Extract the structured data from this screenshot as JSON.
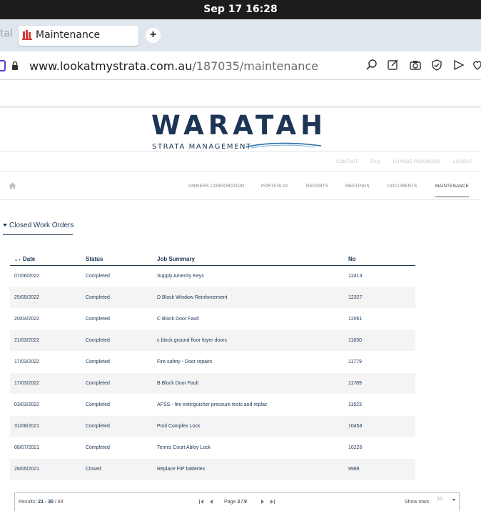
{
  "system": {
    "clock": "Sep 17  16:28"
  },
  "browser": {
    "prev_tab_fragment": "tal",
    "tab_title": "Maintenance",
    "new_tab_symbol": "+",
    "url_host": "www.lookatmystrata.com.au",
    "url_path": "/187035/maintenance"
  },
  "site": {
    "logo_word": "WARATAH",
    "logo_sub": "STRATA MANAGEMENT",
    "top_links": [
      "CONTACT",
      "FAQ",
      "CHANGE PASSWORD",
      "LOGOUT"
    ],
    "nav": [
      "OWNERS CORPORATION",
      "PORTFOLIO",
      "REPORTS",
      "MEETINGS",
      "DOCUMENTS",
      "MAINTENANCE"
    ],
    "active_nav": "MAINTENANCE"
  },
  "section": {
    "title": "Closed Work Orders"
  },
  "table": {
    "columns": [
      "Date",
      "Status",
      "Job Summary",
      "No"
    ],
    "rows": [
      {
        "date": "07/06/2022",
        "status": "Completed",
        "summary": "Supply Amenity Keys",
        "no": "12413"
      },
      {
        "date": "25/05/2022",
        "status": "Completed",
        "summary": "D Block Window Reinforcement",
        "no": "12327"
      },
      {
        "date": "20/04/2022",
        "status": "Completed",
        "summary": "C Block Door Fault",
        "no": "12061"
      },
      {
        "date": "21/03/2022",
        "status": "Completed",
        "summary": "c block ground floor foyer doors",
        "no": "11830"
      },
      {
        "date": "17/03/2022",
        "status": "Completed",
        "summary": "Fire safety - Door repairs",
        "no": "11779"
      },
      {
        "date": "17/03/2022",
        "status": "Completed",
        "summary": "B Block Door Fault",
        "no": "11789"
      },
      {
        "date": "03/03/2022",
        "status": "Completed",
        "summary": "AFSS - fire extinguisher pressure tests and replac",
        "no": "11623"
      },
      {
        "date": "31/08/2021",
        "status": "Completed",
        "summary": "Pool Complex Lock",
        "no": "10458"
      },
      {
        "date": "08/07/2021",
        "status": "Completed",
        "summary": "Tennis Court Abloy Lock",
        "no": "10226"
      },
      {
        "date": "28/05/2021",
        "status": "Closed",
        "summary": "Replace FIP batteries",
        "no": "9988"
      }
    ]
  },
  "pager": {
    "results_label": "Results:",
    "results_range": "21 - 30",
    "results_total": "/ 84",
    "page_label": "Page",
    "page_current": "3 / 9",
    "show_rows_label": "Show rows",
    "rows_value": "10"
  },
  "colors": {
    "brand": "#1c3556",
    "topbar": "#1d1d1d",
    "tabbar": "#dfe6ee"
  }
}
